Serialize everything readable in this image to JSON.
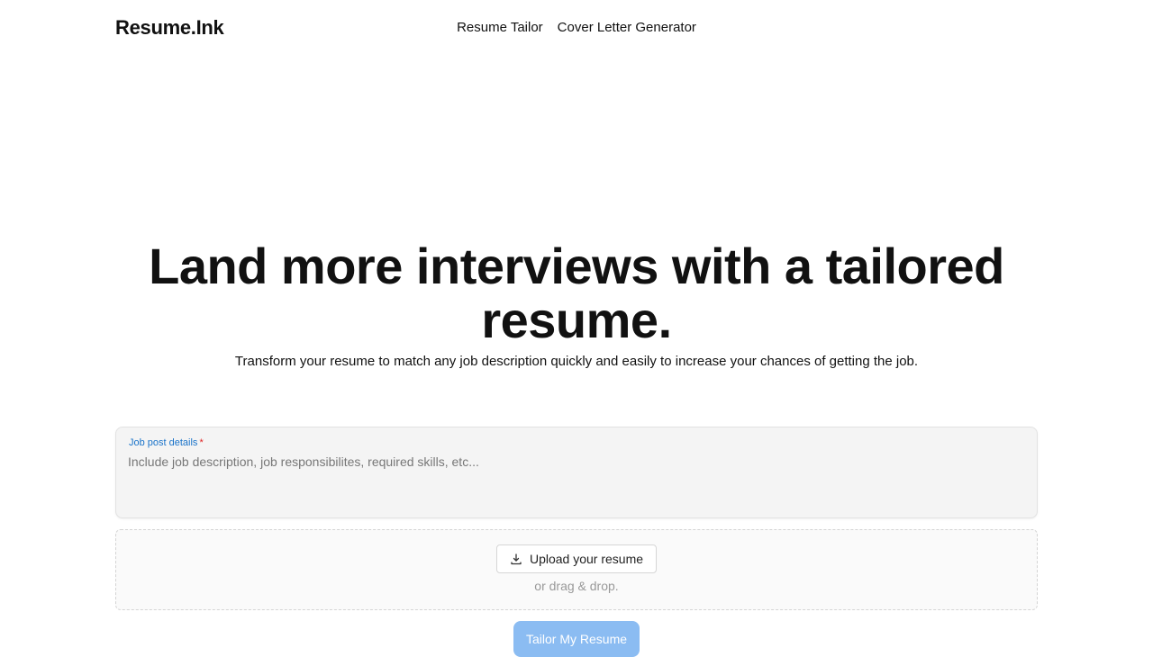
{
  "header": {
    "logo": "Resume.Ink",
    "nav": [
      {
        "label": "Resume Tailor"
      },
      {
        "label": "Cover Letter Generator"
      }
    ]
  },
  "hero": {
    "title_line1": "Land more interviews with a tailored",
    "title_line2": "resume.",
    "subtitle": "Transform your resume to match any job description quickly and easily to increase your chances of getting the job."
  },
  "form": {
    "job_label": "Job post details",
    "required_mark": "*",
    "job_placeholder": "Include job description, job responsibilites, required skills, etc...",
    "job_value": "",
    "upload_label": "Upload your resume",
    "upload_icon": "upload-icon",
    "drag_text": "or drag & drop.",
    "submit_label": "Tailor My Resume"
  },
  "colors": {
    "accent_label": "#1a73c9",
    "required": "#e02424",
    "submit_bg": "#8bbcf2"
  }
}
